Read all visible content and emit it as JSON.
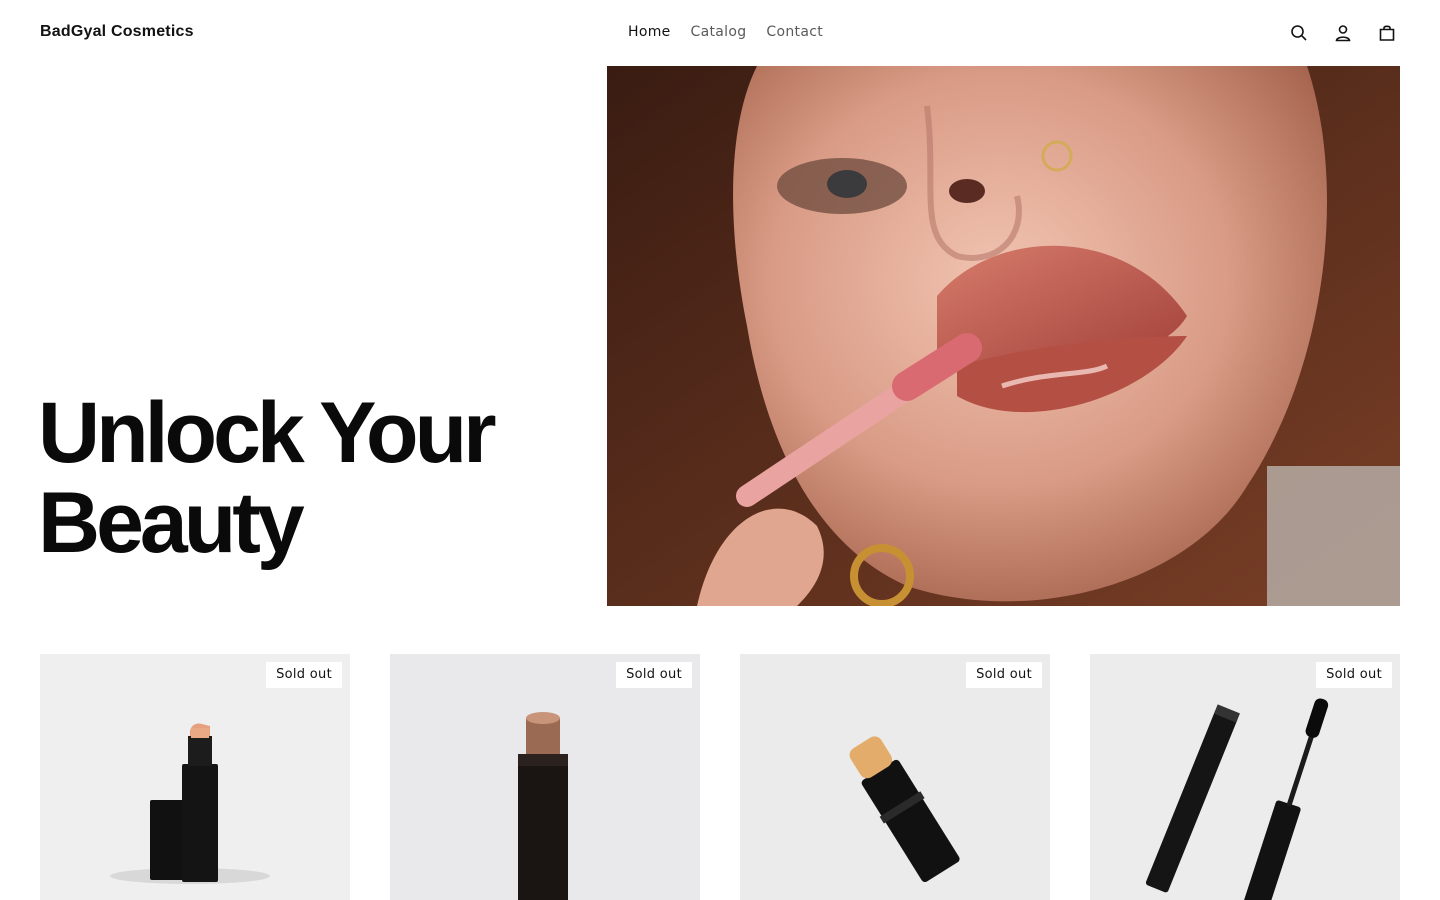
{
  "brand": {
    "name": "BadGyal Cosmetics"
  },
  "nav": {
    "items": [
      {
        "label": "Home",
        "active": true
      },
      {
        "label": "Catalog",
        "active": false
      },
      {
        "label": "Contact",
        "active": false
      }
    ]
  },
  "header_icons": [
    "search-icon",
    "account-icon",
    "cart-icon"
  ],
  "hero": {
    "title_line1": "Unlock Your",
    "title_line2": "Beauty",
    "image": "woman-applying-lip-gloss-photo"
  },
  "products": [
    {
      "image": "peach-lipstick-photo",
      "badge": "Sold out"
    },
    {
      "image": "nude-lip-stick-photo",
      "badge": "Sold out"
    },
    {
      "image": "beige-concealer-stick-photo",
      "badge": "Sold out"
    },
    {
      "image": "black-mascara-photo",
      "badge": "Sold out"
    }
  ],
  "colors": {
    "text": "#121212",
    "muted": "#5a5a5a",
    "background": "#ffffff",
    "card_bg": "#ececec"
  }
}
